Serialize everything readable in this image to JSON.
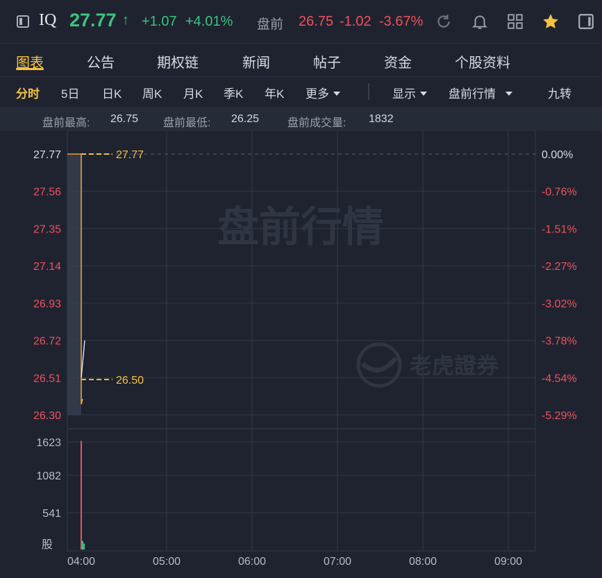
{
  "header": {
    "symbol": "IQ",
    "price": "27.77",
    "price_arrow": "↑",
    "change": "+1.07",
    "change_pct": "+4.01%",
    "premarket_label": "盘前",
    "premarket_price": "26.75",
    "premarket_change": "-1.02",
    "premarket_change_pct": "-3.67%",
    "icons": [
      "sidebar-toggle-icon",
      "refresh-icon",
      "bell-icon",
      "grid-icon",
      "star-icon",
      "panel-icon"
    ],
    "colors": {
      "up": "#3cc47a",
      "down": "#f0525a",
      "accent": "#f5c242"
    }
  },
  "tabs": [
    {
      "label": "图表",
      "active": true
    },
    {
      "label": "公告",
      "active": false
    },
    {
      "label": "期权链",
      "active": false
    },
    {
      "label": "新闻",
      "active": false
    },
    {
      "label": "帖子",
      "active": false
    },
    {
      "label": "资金",
      "active": false
    },
    {
      "label": "个股资料",
      "active": false
    }
  ],
  "periods": {
    "items": [
      "分时",
      "5日",
      "日K",
      "周K",
      "月K",
      "季K",
      "年K",
      "更多"
    ],
    "active": "分时",
    "display": "显示",
    "session": "盘前行情",
    "nine_turn": "九转"
  },
  "stats": {
    "high_label": "盘前最高:",
    "high_value": "26.75",
    "low_label": "盘前最低:",
    "low_value": "26.25",
    "volume_label": "盘前成交量:",
    "volume_value": "1832"
  },
  "chart_data": {
    "type": "line",
    "watermark": "盘前行情",
    "brand_watermark": "老虎證券",
    "y_left_ticks": [
      "27.77",
      "27.56",
      "27.35",
      "27.14",
      "26.93",
      "26.72",
      "26.51",
      "26.30"
    ],
    "y_right_ticks": [
      "0.00%",
      "-0.76%",
      "-1.51%",
      "-2.27%",
      "-3.02%",
      "-3.78%",
      "-4.54%",
      "-5.29%"
    ],
    "ylim": [
      26.3,
      27.77
    ],
    "x_ticks": [
      "04:00",
      "05:00",
      "06:00",
      "07:00",
      "08:00",
      "09:00"
    ],
    "price_series": [
      {
        "t": "04:00",
        "price": 27.77
      },
      {
        "t": "04:00",
        "price": 26.36
      },
      {
        "t": "04:01",
        "price": 26.39
      }
    ],
    "guide_lines": [
      {
        "label": "27.77",
        "value": 27.77
      },
      {
        "label": "26.50",
        "value": 26.5
      }
    ],
    "volume_ticks": [
      "1623",
      "1082",
      "541"
    ],
    "volume_unit": "股",
    "volume_max": 1623,
    "volume_bars": [
      {
        "t": "04:00",
        "volume": 1640,
        "color": "#f0525a"
      },
      {
        "t": "04:01",
        "volume": 130,
        "color": "#3cc47a"
      },
      {
        "t": "04:02",
        "volume": 90,
        "color": "#3cc47a"
      }
    ]
  }
}
